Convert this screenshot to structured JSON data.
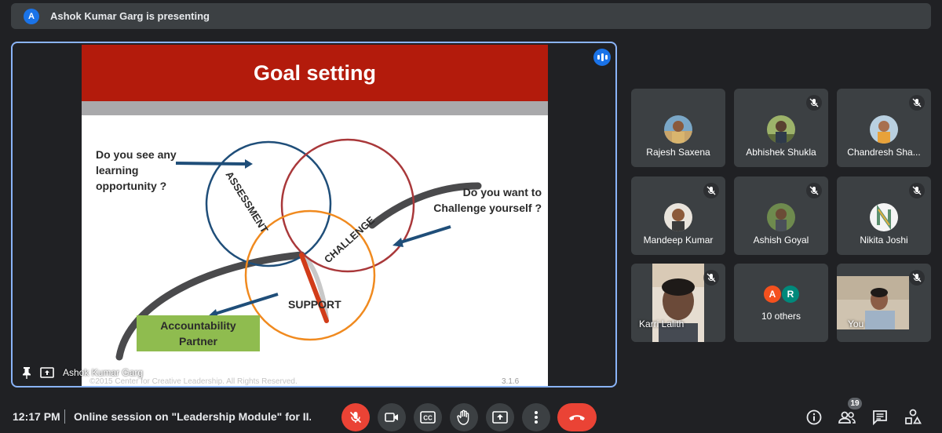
{
  "banner": {
    "avatar_letter": "A",
    "text": "Ashok Kumar Garg is presenting"
  },
  "slide": {
    "title": "Goal setting",
    "question_left": "Do you see any learning opportunity  ?",
    "question_right": "Do you want to Challenge yourself ?",
    "circle_labels": {
      "assessment": "ASSESSMENT",
      "challenge": "CHALLENGE",
      "support": "SUPPORT"
    },
    "box_label": "Accountability Partner",
    "copyright": "©2015 Center for Creative Leadership. All Rights Reserved.",
    "slide_number": "3.1.6",
    "colors": {
      "header": "#b31b0c",
      "band": "#a9a9ab",
      "assessment": "#1f4e79",
      "challenge": "#a9383a",
      "support": "#f08a1f",
      "box": "#8fbc4f"
    }
  },
  "stage": {
    "presenter_name": "Ashok Kumar Garg",
    "icons": [
      "pin-icon",
      "present-icon",
      "speaking-indicator-icon"
    ]
  },
  "participants": [
    {
      "name": "Rajesh Saxena",
      "muted": false
    },
    {
      "name": "Abhishek Shukla",
      "muted": true
    },
    {
      "name": "Chandresh Sha...",
      "muted": true
    },
    {
      "name": "Mandeep Kumar",
      "muted": true
    },
    {
      "name": "Ashish Goyal",
      "muted": true
    },
    {
      "name": "Nikita Joshi",
      "muted": true
    },
    {
      "name": "Karri Lalith",
      "muted": true
    },
    {
      "name": "10 others",
      "avatars": [
        "A",
        "R"
      ]
    },
    {
      "name": "You",
      "muted": true
    }
  ],
  "bottom_bar": {
    "time": "12:17 PM",
    "meeting_title": "Online session on \"Leadership Module\" for II...",
    "controls": [
      "mic-off-icon",
      "camera-icon",
      "captions-icon",
      "raise-hand-icon",
      "present-screen-icon",
      "more-options-icon",
      "end-call-icon"
    ],
    "captions_label": "CC",
    "right_icons": [
      "info-icon",
      "people-icon",
      "chat-icon",
      "activities-icon"
    ],
    "people_count": "19"
  }
}
